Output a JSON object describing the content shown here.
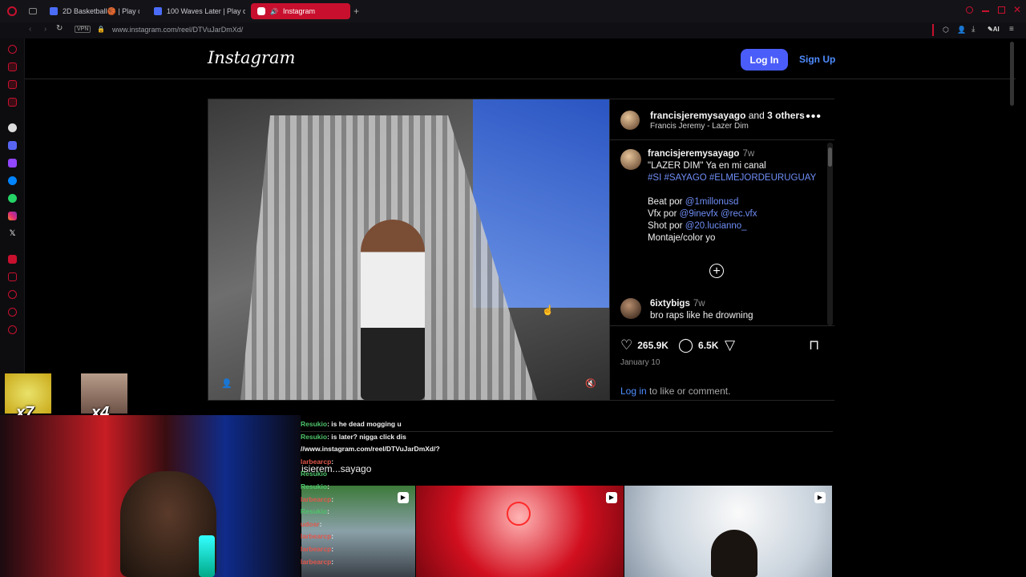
{
  "browser": {
    "tabs": [
      {
        "label": "2D Basketball🏀 | Play on",
        "active": false
      },
      {
        "label": "100 Waves Later | Play on",
        "active": false
      },
      {
        "label": "Instagram",
        "active": true
      }
    ],
    "url": "www.instagram.com/reel/DTVuJarDmXd/",
    "vpn_label": "VPN",
    "ai_label": "AI"
  },
  "header": {
    "logo": "Instagram",
    "login": "Log In",
    "signup": "Sign Up"
  },
  "post": {
    "owner": "francisjeremysayago",
    "owner_and": "and",
    "owner_others": "3 others",
    "audio": "Francis Jeremy - Lazer Dim",
    "caption": {
      "user": "francisjeremysayago",
      "time": "7w",
      "line1": "\"LAZER DIM\" Ya en mi canal",
      "hashtags": "#SI #SAYAGO #ELMEJORDEURUGUAY",
      "beat_prefix": "Beat por",
      "beat_link": "@1millonusd",
      "vfx_prefix": "Vfx por",
      "vfx_link": "@9inevfx @rec.vfx",
      "shot_prefix": "Shot por",
      "shot_link": "@20.lucianno_",
      "montaje": "Montaje/color yo"
    },
    "comment": {
      "user": "6ixtybigs",
      "time": "7w",
      "text": "bro raps like he drowning"
    },
    "likes": "265.9K",
    "comments_count": "6.5K",
    "date": "January 10",
    "login_link": "Log in",
    "login_suffix": "to like or comment."
  },
  "more_from": "isierem...sayago",
  "overlay": {
    "mult1": "x7",
    "mult2": "x4",
    "chat": [
      {
        "name": "Resukio",
        "msg": ": is he dead mogging u"
      },
      {
        "name": "Resukio",
        "msg": ": is later? nigga click dis"
      },
      {
        "name": "",
        "msg": "//www.instagram.com/reel/DTVuJarDmXd/?"
      },
      {
        "name": "larbearcp",
        "msg": ":"
      },
      {
        "name": "Resukio",
        "msg": ""
      },
      {
        "name": "Resukio",
        "msg": ":"
      },
      {
        "name": "larbearcp",
        "msg": ":"
      },
      {
        "name": "Resukio",
        "msg": ":"
      },
      {
        "name": "udosr",
        "msg": ":"
      },
      {
        "name": "larbearcp",
        "msg": ":"
      },
      {
        "name": "larbearcp",
        "msg": ":"
      },
      {
        "name": "larbearcp",
        "msg": ":"
      }
    ]
  },
  "colors": {
    "accent_red": "#c8102e",
    "ig_blue_button": "#4a5df9",
    "ig_link": "#4f8cff"
  }
}
